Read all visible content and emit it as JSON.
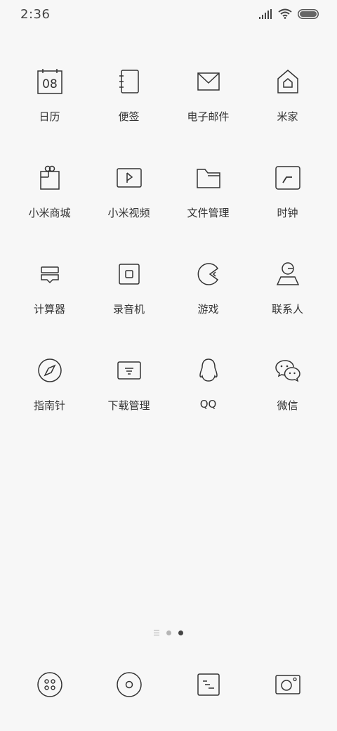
{
  "status": {
    "time": "2:36"
  },
  "apps": [
    {
      "label": "日历",
      "icon": "calendar-icon",
      "date": "08"
    },
    {
      "label": "便签",
      "icon": "notes-icon"
    },
    {
      "label": "电子邮件",
      "icon": "mail-icon"
    },
    {
      "label": "米家",
      "icon": "mi-home-icon"
    },
    {
      "label": "小米商城",
      "icon": "mi-store-icon"
    },
    {
      "label": "小米视频",
      "icon": "mi-video-icon"
    },
    {
      "label": "文件管理",
      "icon": "folder-icon"
    },
    {
      "label": "时钟",
      "icon": "clock-icon"
    },
    {
      "label": "计算器",
      "icon": "calculator-icon"
    },
    {
      "label": "录音机",
      "icon": "recorder-icon"
    },
    {
      "label": "游戏",
      "icon": "game-icon"
    },
    {
      "label": "联系人",
      "icon": "contacts-icon"
    },
    {
      "label": "指南针",
      "icon": "compass-icon"
    },
    {
      "label": "下载管理",
      "icon": "download-icon"
    },
    {
      "label": "QQ",
      "icon": "qq-icon"
    },
    {
      "label": "微信",
      "icon": "wechat-icon"
    }
  ],
  "page_indicator": {
    "current": 2,
    "total": 2
  },
  "dock": [
    {
      "icon": "phone-dialer-icon"
    },
    {
      "icon": "messaging-icon"
    },
    {
      "icon": "browser-icon"
    },
    {
      "icon": "camera-icon"
    }
  ]
}
